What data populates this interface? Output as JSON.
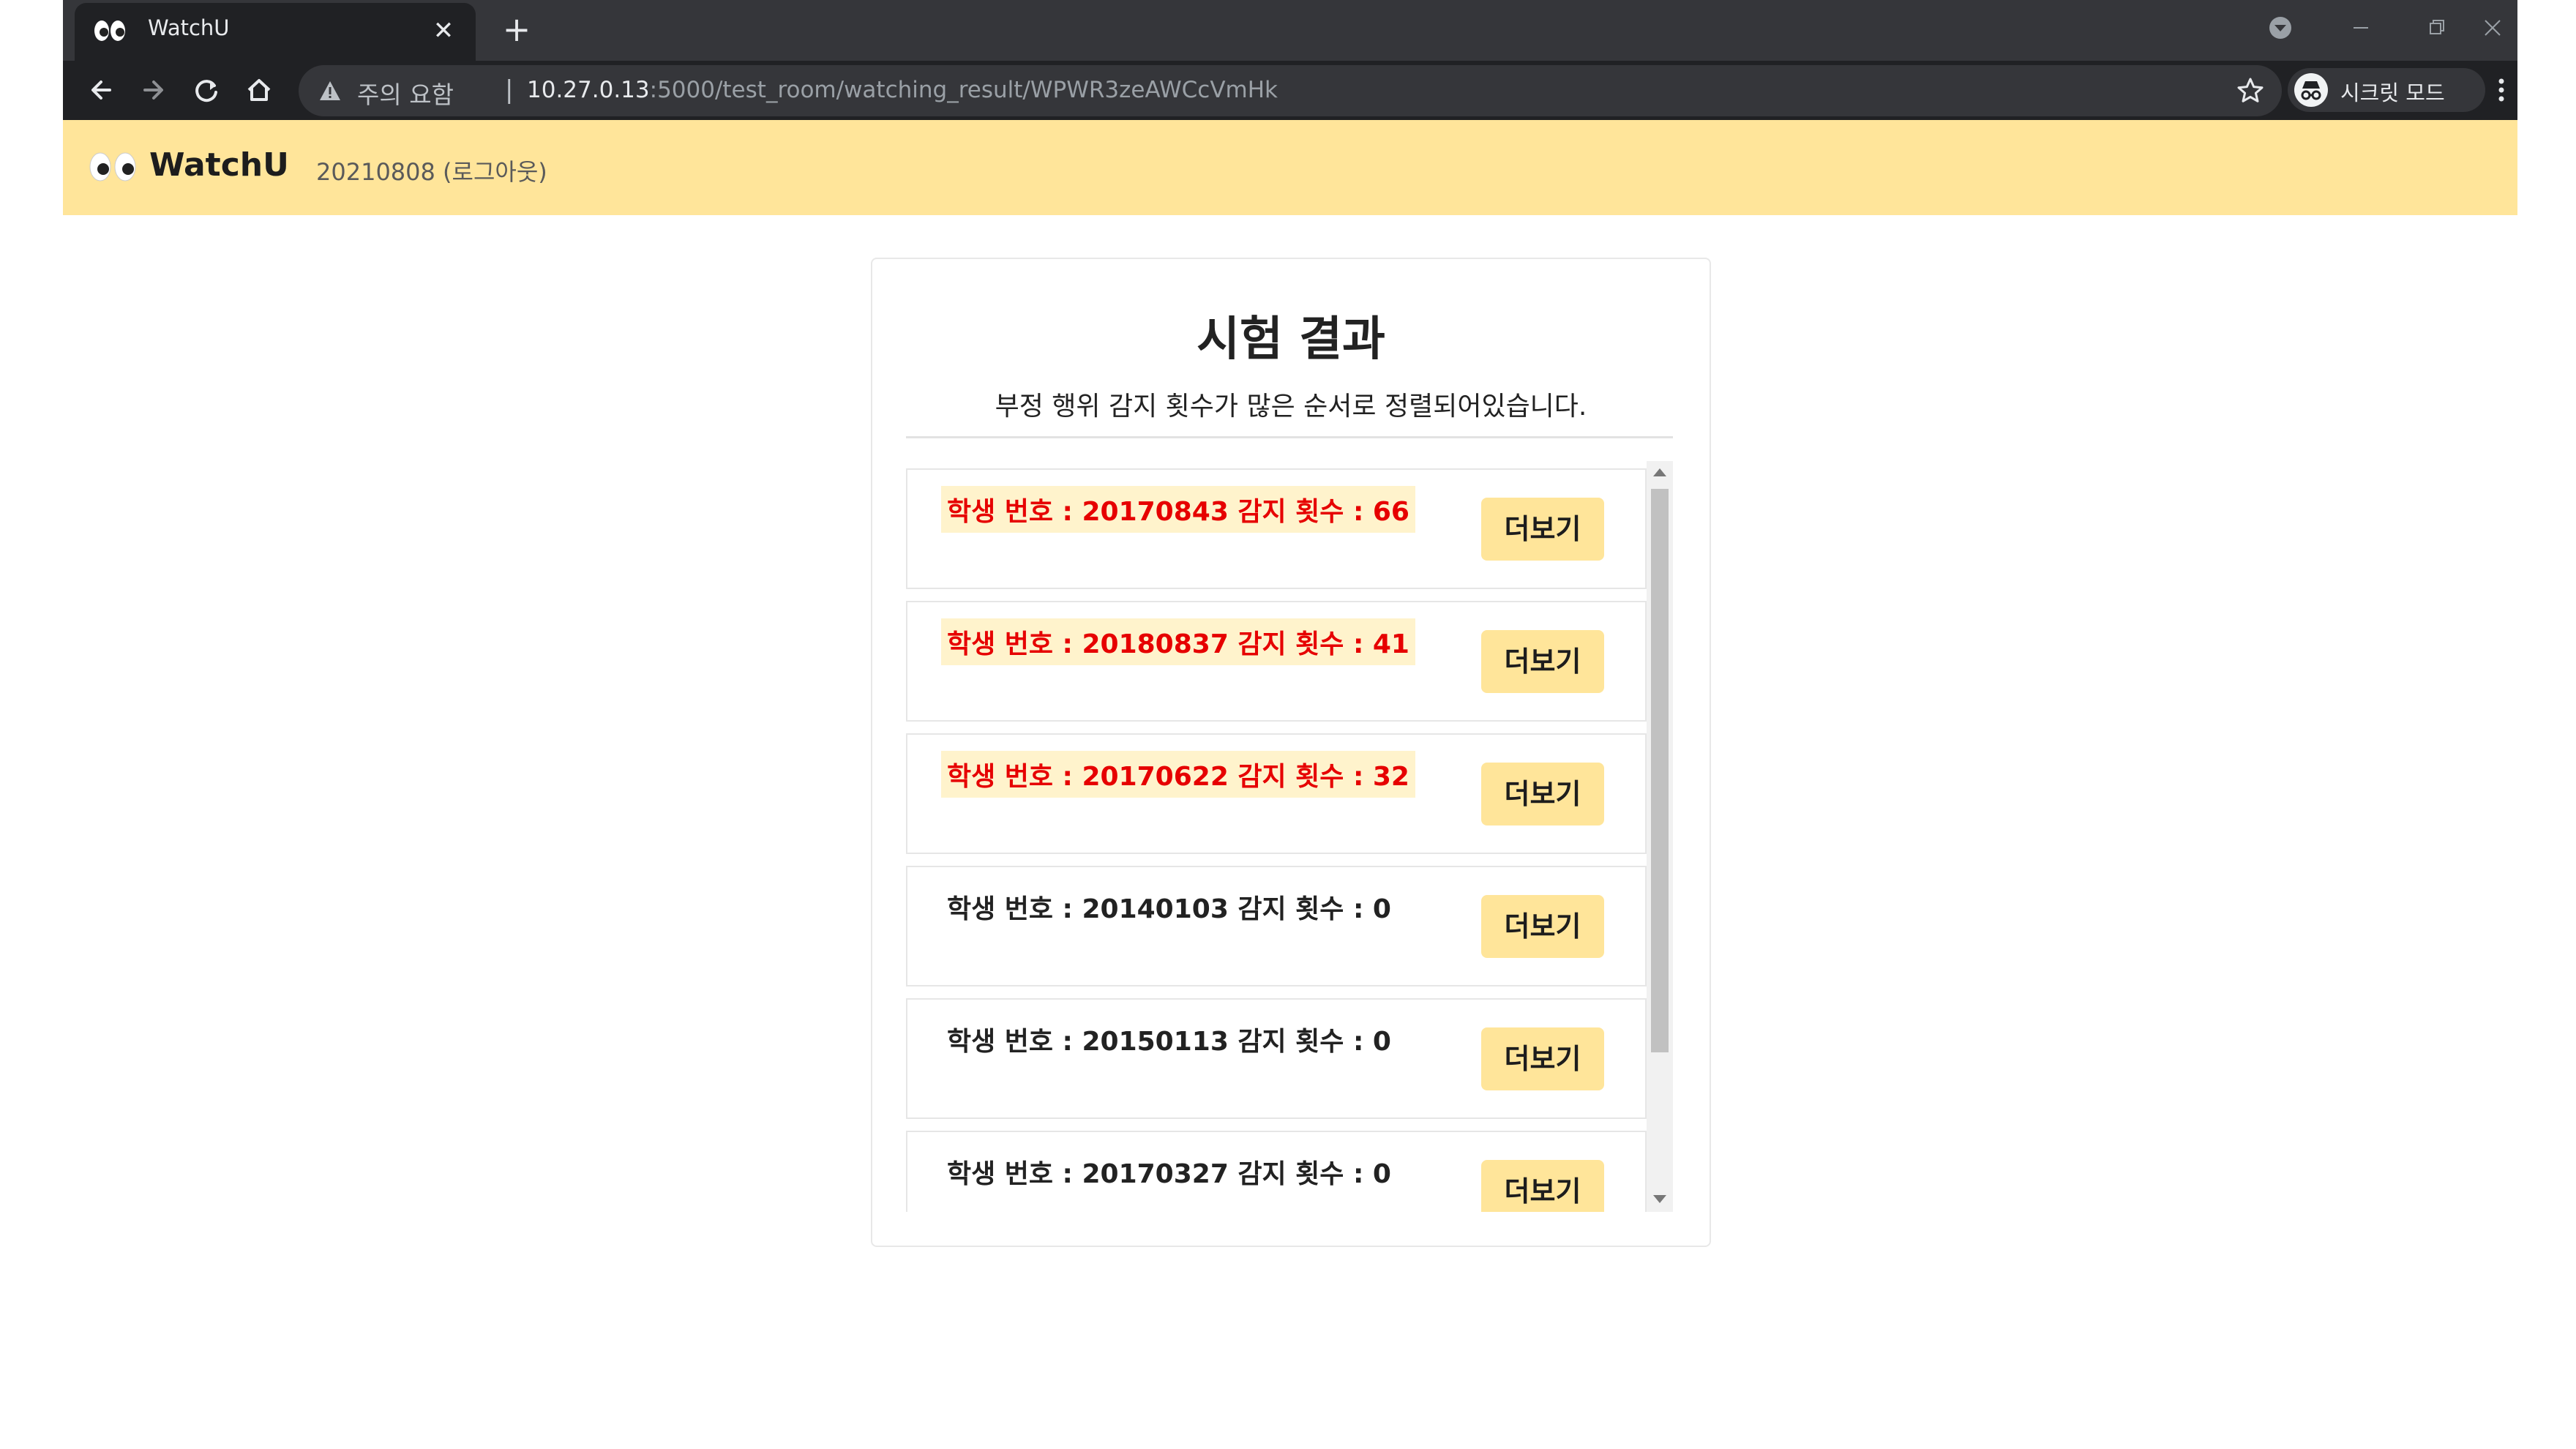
{
  "browser": {
    "tab_title": "WatchU",
    "security_label": "주의 요함",
    "separator": "|",
    "url_host": "10.27.0.13",
    "url_path": ":5000/test_room/watching_result/WPWR3zeAWCcVmHk",
    "incognito_label": "시크릿 모드"
  },
  "appbar": {
    "brand": "WatchU",
    "user_link": "20210808 (로그아웃)"
  },
  "result": {
    "title": "시험 결과",
    "subtitle": "부정 행위 감지 횟수가 많은 순서로 정렬되어있습니다.",
    "more_label": "더보기",
    "highlight_color": "#e60000",
    "rows": [
      {
        "label": "학생 번호 : 20170843 감지 횟수 : 66",
        "flagged": true
      },
      {
        "label": "학생 번호 : 20180837 감지 횟수 : 41",
        "flagged": true
      },
      {
        "label": "학생 번호 : 20170622 감지 횟수 : 32",
        "flagged": true
      },
      {
        "label": "학생 번호 : 20140103 감지 횟수 : 0",
        "flagged": false
      },
      {
        "label": "학생 번호 : 20150113 감지 횟수 : 0",
        "flagged": false
      },
      {
        "label": "학생 번호 : 20170327 감지 횟수 : 0",
        "flagged": false
      }
    ]
  }
}
